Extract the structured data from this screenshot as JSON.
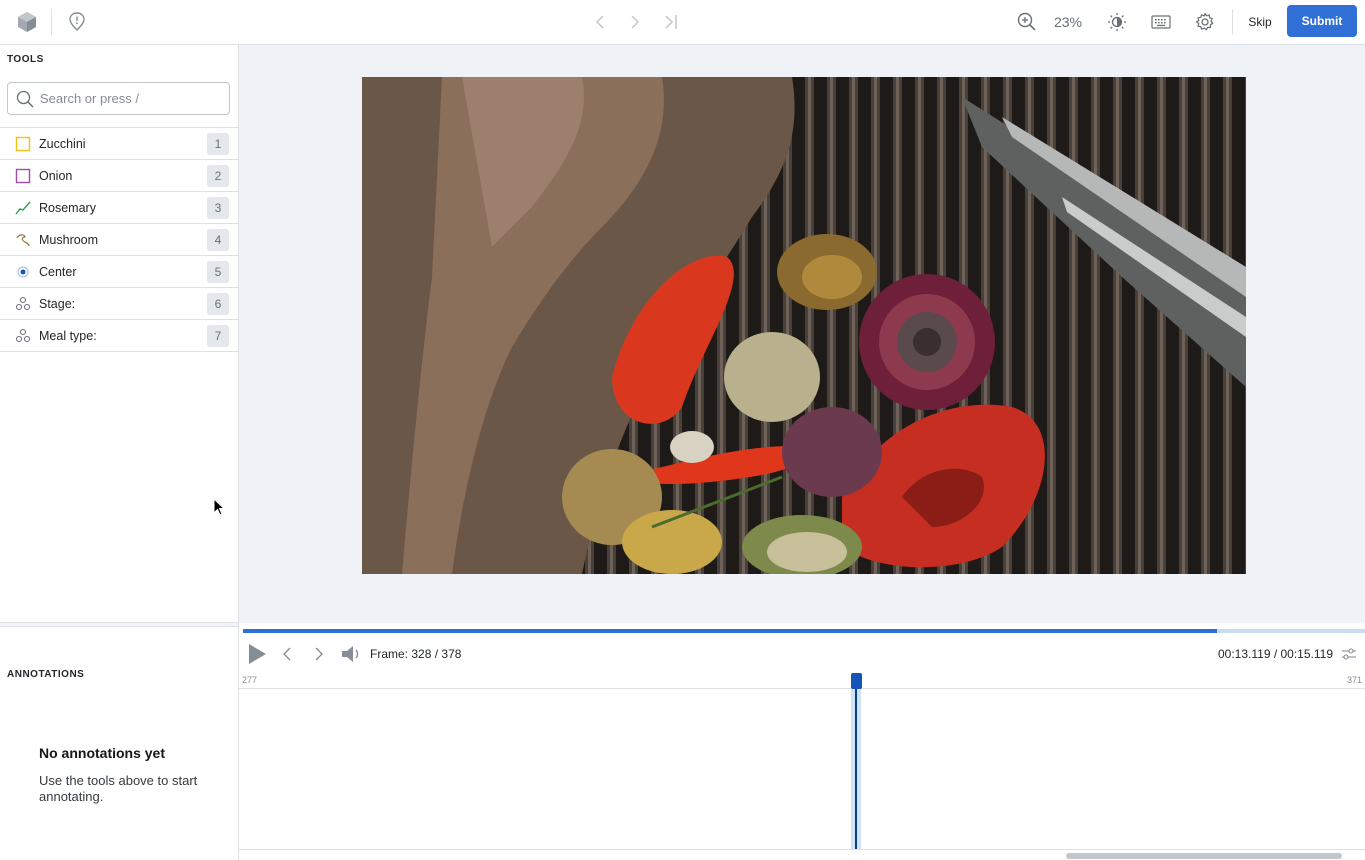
{
  "topbar": {
    "zoom": "23%",
    "skip_label": "Skip",
    "submit_label": "Submit"
  },
  "tools": {
    "title": "TOOLS",
    "search_placeholder": "Search or press /",
    "items": [
      {
        "label": "Zucchini",
        "key": "1",
        "icon": "square-yellow-icon",
        "color": "#f1c21b"
      },
      {
        "label": "Onion",
        "key": "2",
        "icon": "square-purple-icon",
        "color": "#8a3ffc"
      },
      {
        "label": "Rosemary",
        "key": "3",
        "icon": "polyline-icon",
        "color": "#24a148"
      },
      {
        "label": "Mushroom",
        "key": "4",
        "icon": "polygon-icon",
        "color": "#8e6a3d"
      },
      {
        "label": "Center",
        "key": "5",
        "icon": "point-icon",
        "color": "#1356b8"
      },
      {
        "label": "Stage:",
        "key": "6",
        "icon": "classification-icon",
        "color": "#697077"
      },
      {
        "label": "Meal type:",
        "key": "7",
        "icon": "classification-icon",
        "color": "#697077"
      }
    ]
  },
  "annotations": {
    "title": "ANNOTATIONS",
    "empty_title": "No annotations yet",
    "empty_text": "Use the tools above to start annotating."
  },
  "timeline": {
    "frame_label": "Frame:",
    "frame_current": "328",
    "frame_total": "/ 378",
    "time": "00:13.119 / 00:15.119",
    "range_start": "277",
    "range_end": "371",
    "progress": 0.868
  }
}
